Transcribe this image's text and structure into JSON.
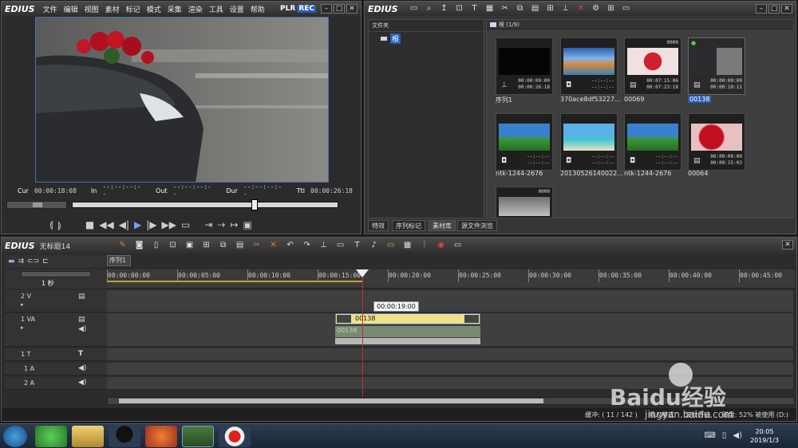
{
  "player": {
    "logo": "EDIUS",
    "menu": [
      "文件",
      "编辑",
      "视图",
      "素材",
      "标记",
      "模式",
      "采集",
      "渲染",
      "工具",
      "设置",
      "帮助"
    ],
    "plr": "PLR",
    "rec": "REC",
    "cur_label": "Cur",
    "cur_value": "00:00:18:08",
    "in_label": "In",
    "in_value": "--:--:--:--",
    "out_label": "Out",
    "out_value": "--:--:--:--",
    "dur_label": "Dur",
    "dur_value": "--:--:--:--",
    "ttl_label": "Ttl",
    "ttl_value": "00:00:26:18"
  },
  "bin": {
    "logo": "EDIUS",
    "folder_header": "文件夹",
    "root_label": "根",
    "path": "根 (1/9)",
    "items": [
      {
        "name": "序列1",
        "tc1": "00:00:00:00",
        "tc2": "00:00:26:18",
        "type": "seq",
        "top": ""
      },
      {
        "name": "370ace8df53227...",
        "tc1": "--:--:--",
        "tc2": "--:--:--",
        "type": "img",
        "top": ""
      },
      {
        "name": "00069",
        "tc1": "00:07:15:06",
        "tc2": "00:07:23:18",
        "type": "vid",
        "top": "0000"
      },
      {
        "name": "00138",
        "tc1": "00:00:00:00",
        "tc2": "00:00:10:11",
        "type": "vid",
        "top": ""
      },
      {
        "name": "ntk-1244-2676",
        "tc1": "--:--:--",
        "tc2": "--:--:--",
        "type": "img",
        "top": ""
      },
      {
        "name": "20130526140022...",
        "tc1": "--:--:--",
        "tc2": "--:--:--",
        "type": "img",
        "top": ""
      },
      {
        "name": "ntk-1244-2676",
        "tc1": "--:--:--",
        "tc2": "--:--:--",
        "type": "img",
        "top": ""
      },
      {
        "name": "00064",
        "tc1": "00:00:00:00",
        "tc2": "00:00:15:03",
        "type": "vid",
        "top": ""
      },
      {
        "name": "",
        "tc1": "",
        "tc2": "",
        "type": "vid",
        "top": "0000"
      }
    ],
    "tabs": [
      "特效",
      "序列标记",
      "素材库",
      "源文件浏览"
    ]
  },
  "timeline": {
    "logo": "EDIUS",
    "project": "无标题14",
    "sequence_tab": "序列1",
    "scale": "1 秒",
    "ruler": [
      "00:00:00:00",
      "00:00:05:00",
      "00:00:10:00",
      "00:00:15:00",
      "00:00:20:00",
      "00:00:25:00",
      "00:00:30:00",
      "00:00:35:00",
      "00:00:40:00",
      "00:00:45:00"
    ],
    "tooltip": "00:00:19:00",
    "tracks": [
      "2 V",
      "1 VA",
      "1 T",
      "1 A",
      "2 A"
    ],
    "clip_name": "00138",
    "audio_clip_name": "00138",
    "status": {
      "buffer": "缓冲:  ( 11 / 142 )",
      "mode": "插入模式",
      "overwrite": "波纹开启",
      "disk": "磁盘: 52% 被使用 (D:)"
    }
  },
  "taskbar": {
    "time": "20:05",
    "date": "2019/1/3"
  },
  "watermark": {
    "brand": "Baidu经验",
    "url": "jingyan.baidu.com"
  }
}
